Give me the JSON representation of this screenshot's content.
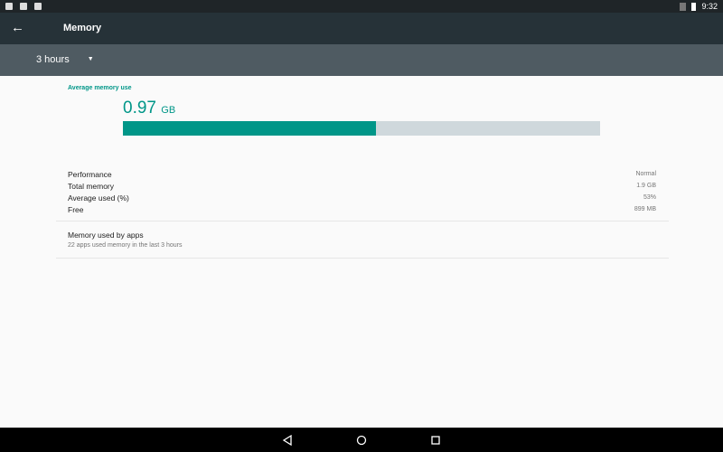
{
  "status_bar": {
    "time": "9:32",
    "icons": [
      "image-icon",
      "lock-icon",
      "sd-card-icon"
    ],
    "right_icons": [
      "no-sim-icon",
      "battery-icon"
    ]
  },
  "app_bar": {
    "title": "Memory",
    "back_icon": "arrow-left-icon"
  },
  "filter": {
    "selected": "3 hours"
  },
  "summary": {
    "label": "Average memory use",
    "value": "0.97",
    "unit": "GB",
    "used_percent": 53,
    "accent": "#009688",
    "track": "#cfd8dc"
  },
  "stats": [
    {
      "label": "Performance",
      "value": "Normal"
    },
    {
      "label": "Total memory",
      "value": "1.9 GB"
    },
    {
      "label": "Average used (%)",
      "value": "53%"
    },
    {
      "label": "Free",
      "value": "899 MB"
    }
  ],
  "apps": {
    "title": "Memory used by apps",
    "subtitle": "22 apps used memory in the last 3 hours"
  },
  "nav": [
    "back-icon",
    "home-icon",
    "recents-icon"
  ]
}
